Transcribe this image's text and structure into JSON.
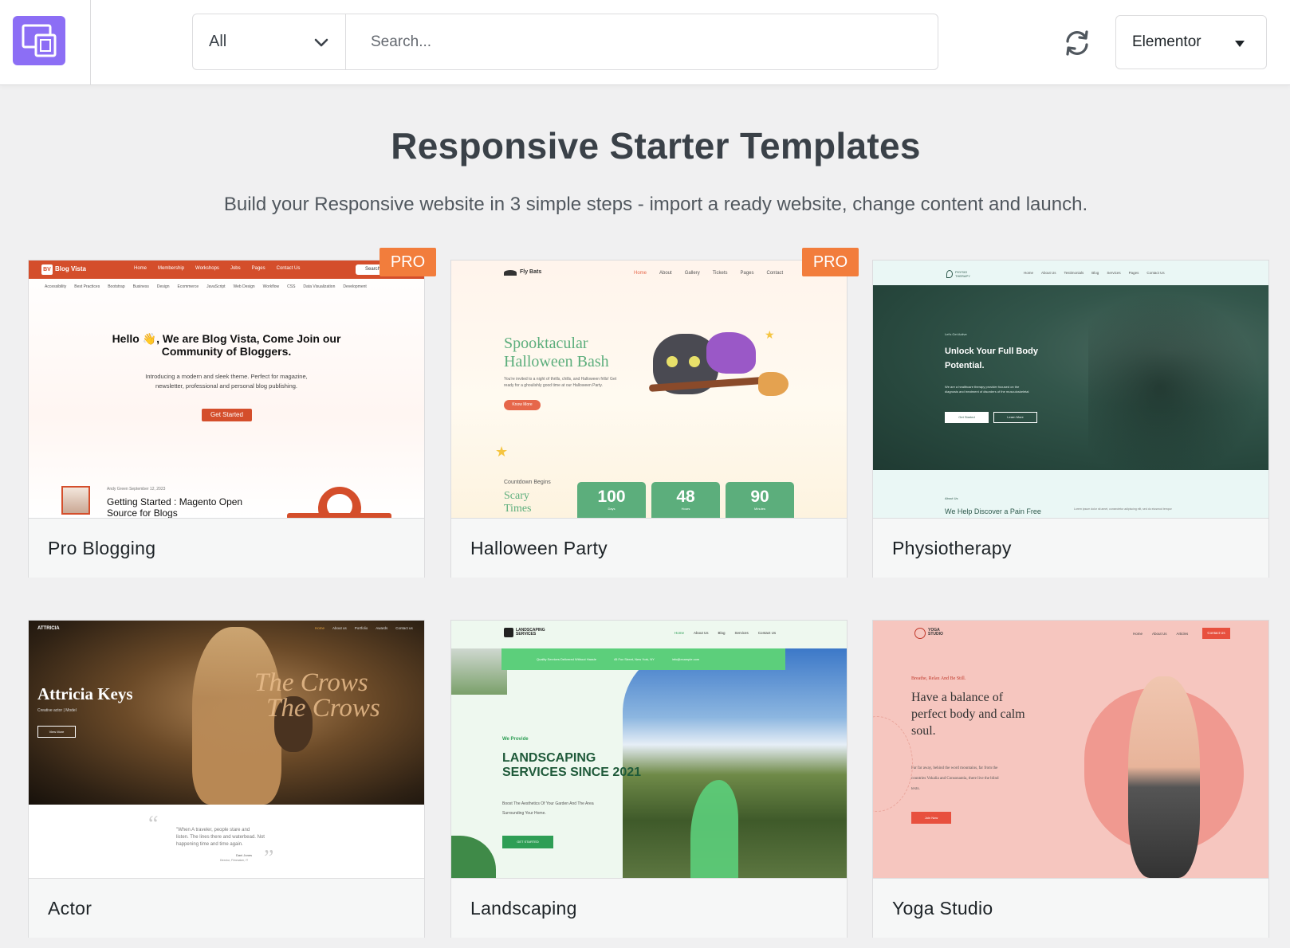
{
  "header": {
    "filter": {
      "selected": "All"
    },
    "search": {
      "placeholder": "Search..."
    },
    "builder": {
      "selected": "Elementor"
    }
  },
  "main": {
    "title": "Responsive Starter Templates",
    "subtitle": "Build your Responsive website in 3 simple steps - import a ready website, change content and launch."
  },
  "templates": [
    {
      "name": "Pro Blogging",
      "badge": "PRO",
      "preview": {
        "brand": "Blog Vista",
        "nav": [
          "Home",
          "Membership",
          "Workshops",
          "Jobs",
          "Pages",
          "Contact Us"
        ],
        "search": "Search",
        "categories": [
          "Accessibility",
          "Best Practices",
          "Bootstrap",
          "Business",
          "Design",
          "Ecommerce",
          "JavaScript",
          "Web Design",
          "Workflow",
          "CSS",
          "Data Visualization",
          "Development"
        ],
        "headline_1": "Hello 👋, We are Blog Vista, Come Join our",
        "headline_2": "Community of Bloggers.",
        "text_1": "Introducing a modern and sleek theme. Perfect for magazine,",
        "text_2": "newsletter, professional and personal blog publishing.",
        "cta": "Get Started",
        "post_meta": "Andy Green  September 12, 2023",
        "post_title_1": "Getting Started : Magento Open",
        "post_title_2": "Source for Blogs"
      }
    },
    {
      "name": "Halloween Party",
      "badge": "PRO",
      "preview": {
        "brand": "Fly Bats",
        "nav": [
          "Home",
          "About",
          "Gallery",
          "Tickets",
          "Pages",
          "Contact"
        ],
        "headline_1": "Spooktacular",
        "headline_2": "Halloween Bash",
        "text_1": "You're invited to a night of thrills, chills, and Halloween frills! Get",
        "text_2": "ready for a ghoulishly good time at our Halloween Party.",
        "cta": "Know More",
        "countdown_label": "Countdown Begins",
        "scary_1": "Scary",
        "scary_2": "Times",
        "countdown": [
          {
            "value": "100",
            "unit": "Days"
          },
          {
            "value": "48",
            "unit": "Hours"
          },
          {
            "value": "90",
            "unit": "Minutes"
          }
        ]
      }
    },
    {
      "name": "Physiotherapy",
      "preview": {
        "brand": "PHYSIO THERAPY",
        "nav": [
          "Home",
          "About Us",
          "Testimonials",
          "Blog",
          "Services",
          "Pages",
          "Contact Us"
        ],
        "kicker": "Let's Get Active",
        "headline_1": "Unlock Your Full Body",
        "headline_2": "Potential.",
        "text_1": "We are a healthcare therapy provider focused on the",
        "text_2": "diagnosis and treatment of disorders of the musculoskeletal",
        "btn_1": "Get Started",
        "btn_2": "Learn More",
        "section_kicker": "About Us",
        "section_title": "We Help Discover a Pain Free",
        "section_text": "Lorem ipsum dolor sit amet, consectetur adipiscing elit, sed do eiusmod tempor"
      }
    },
    {
      "name": "Actor",
      "preview": {
        "brand": "ATTRICIA",
        "nav": [
          "Home",
          "About us",
          "Portfolio",
          "Awards",
          "Contact us"
        ],
        "hero_name": "Attricia Keys",
        "role": "Creative actor | Model",
        "cta": "View More",
        "overlay_1": "The Crows",
        "overlay_2": "The Crows",
        "quote_1": "\"When A traveler, people stare and",
        "quote_2": "listen. The lines there and waterbead. Not",
        "quote_3": "happening time and time again.",
        "author": "Dani Jones",
        "author_role": "Director, Filmmaker, IT"
      }
    },
    {
      "name": "Landscaping",
      "preview": {
        "brand": "LANDSCAPING",
        "brand_sub": "SERVICES",
        "nav": [
          "Home",
          "About Us",
          "Blog",
          "Services",
          "Contact Us"
        ],
        "info_1": "Quality Services Delivered Without Hassle",
        "info_2": "45 Fox Street, New York, NY",
        "info_3": "info@example.com",
        "kicker": "We Provide",
        "headline_1": "LANDSCAPING",
        "headline_2": "SERVICES SINCE 2021",
        "text_1": "Boost The Aesthetics Of Your Garden And The Area",
        "text_2": "Surrounding Your Home.",
        "cta": "GET STARTED"
      }
    },
    {
      "name": "Yoga Studio",
      "preview": {
        "brand": "YOGA",
        "brand_sub": "STUDIO",
        "nav": [
          "Home",
          "About Us",
          "Articles"
        ],
        "nav_cta": "Contact Us",
        "kicker": "Breathe, Relax And Be Still.",
        "headline_1": "Have a balance of",
        "headline_2": "perfect body and calm",
        "headline_3": "soul.",
        "text_1": "Far far away, behind the word mountains, far from the",
        "text_2": "countries Vokalia and Consonantia, there live the blind",
        "text_3": "texts.",
        "cta": "Join Now"
      }
    }
  ],
  "colors": {
    "accent": "#8c6ef5",
    "pro_badge": "#f27d3c",
    "blog_red": "#d44e2b",
    "halloween_green": "#5cae7c",
    "physio_green": "#2f5a4d",
    "landscape_green": "#5ccf7b",
    "yoga_pink": "#f4b3ab"
  }
}
